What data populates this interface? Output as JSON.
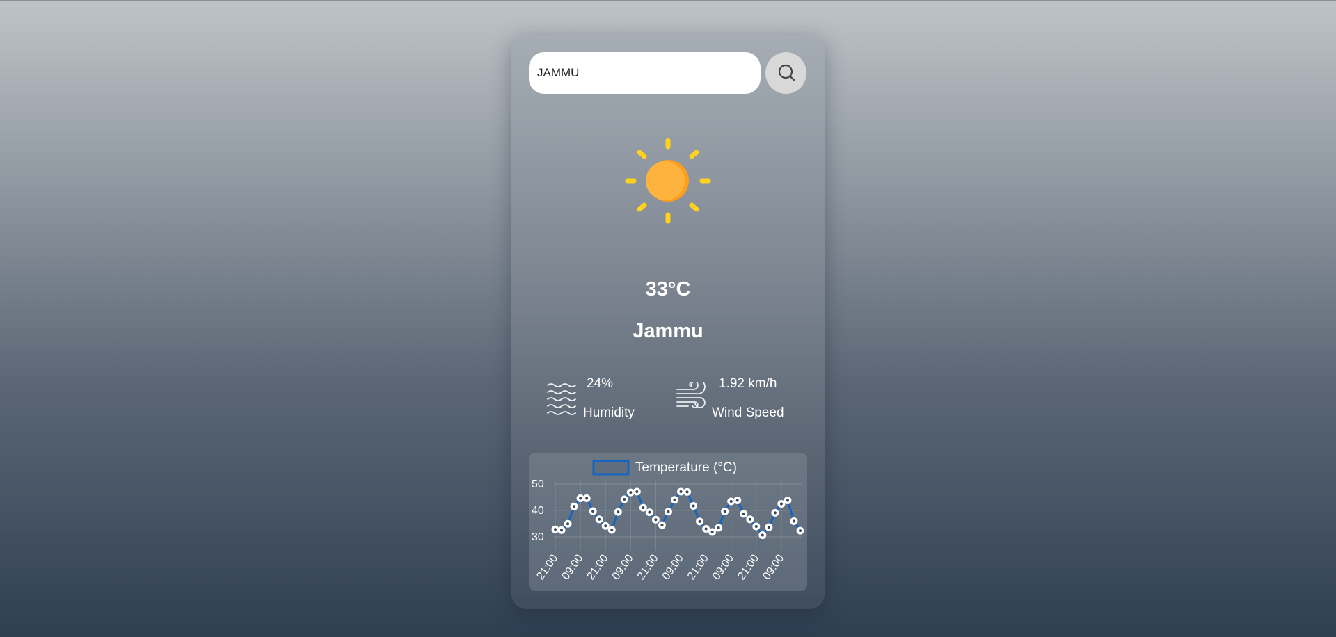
{
  "search": {
    "value": "JAMMU",
    "button_icon": "search-icon"
  },
  "weather": {
    "icon": "sun-icon",
    "temperature": "33°C",
    "city": "Jammu",
    "humidity": {
      "value": "24%",
      "label": "Humidity",
      "icon": "humidity-waves-icon"
    },
    "wind": {
      "value": "1.92 km/h",
      "label": "Wind Speed",
      "icon": "wind-icon"
    }
  },
  "colors": {
    "line": "#1565c0",
    "sun": "#ffb13d",
    "rays": "#ffd21f"
  },
  "chart_data": {
    "type": "line",
    "legend": {
      "placement": "top",
      "entries": [
        "Temperature (°C)"
      ]
    },
    "series": [
      {
        "name": "Temperature (°C)",
        "values": [
          32.8,
          32.5,
          34.9,
          41.5,
          44.6,
          44.6,
          39.7,
          36.6,
          34.1,
          32.6,
          39.4,
          44.2,
          46.8,
          47.1,
          41.0,
          39.3,
          36.5,
          34.4,
          39.5,
          44.0,
          47.1,
          47.0,
          41.7,
          35.8,
          33.0,
          31.8,
          33.4,
          39.6,
          43.4,
          43.8,
          38.7,
          36.6,
          33.9,
          30.6,
          33.6,
          39.1,
          42.5,
          43.8,
          35.9,
          32.3
        ]
      }
    ],
    "tick_labels": [
      "21:00",
      "09:00",
      "21:00",
      "09:00",
      "21:00",
      "09:00",
      "21:00",
      "09:00",
      "21:00",
      "09:00"
    ],
    "yticks": [
      30,
      40,
      50
    ],
    "ylim": [
      26,
      50
    ],
    "grid": true
  }
}
